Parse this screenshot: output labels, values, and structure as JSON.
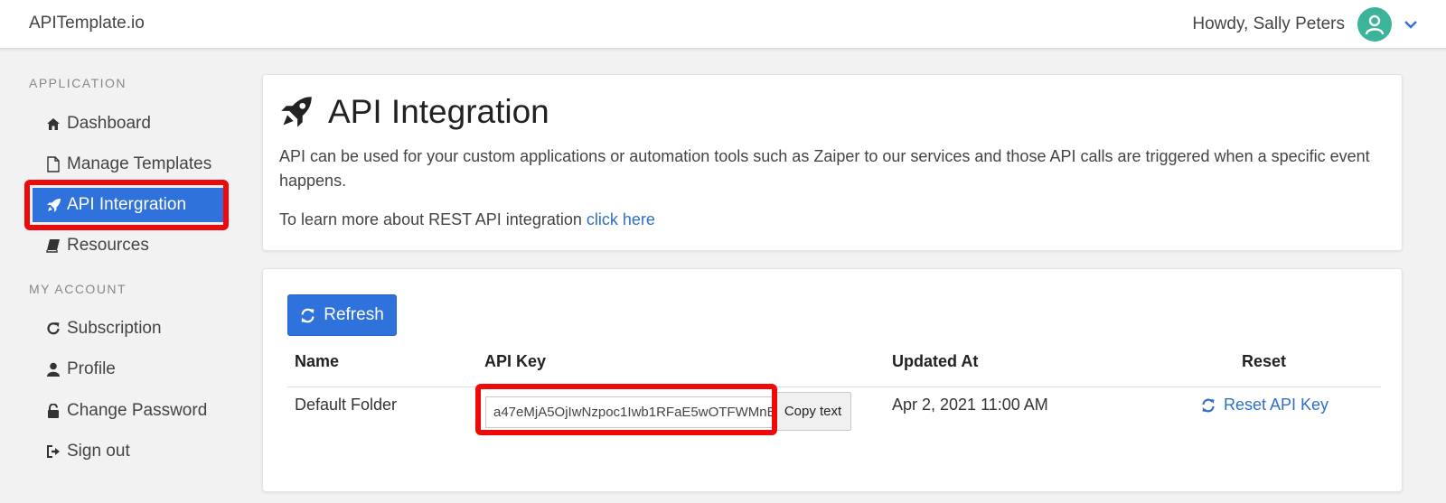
{
  "header": {
    "brand": "APITemplate.io",
    "greeting": "Howdy, Sally Peters",
    "avatar_color": "#3cb499"
  },
  "sidebar": {
    "sections": [
      {
        "title": "APPLICATION",
        "items": [
          {
            "label": "Dashboard",
            "icon": "home-icon"
          },
          {
            "label": "Manage Templates",
            "icon": "file-icon"
          },
          {
            "label": "API Intergration",
            "icon": "rocket-icon",
            "active": true
          },
          {
            "label": "Resources",
            "icon": "book-icon"
          }
        ]
      },
      {
        "title": "MY ACCOUNT",
        "items": [
          {
            "label": "Subscription",
            "icon": "refresh-icon"
          },
          {
            "label": "Profile",
            "icon": "user-icon"
          },
          {
            "label": "Change Password",
            "icon": "unlock-icon"
          },
          {
            "label": "Sign out",
            "icon": "sign-out-icon"
          }
        ]
      }
    ]
  },
  "main": {
    "title": "API Integration",
    "description": "API can be used for your custom applications or automation tools such as Zaiper to our services and those API calls are triggered when a specific event happens.",
    "learn_more_text": "To learn more about REST API integration",
    "learn_more_link": "click here",
    "refresh_label": "Refresh",
    "table": {
      "headers": [
        "Name",
        "API Key",
        "Updated At",
        "Reset"
      ],
      "rows": [
        {
          "name": "Default Folder",
          "api_key": "a47eMjA5OjIwNzpoc1Iwb1RFaE5wOTFWMnE",
          "copy_label": "Copy text",
          "updated_at": "Apr 2, 2021 11:00 AM",
          "reset_label": "Reset API Key"
        }
      ]
    }
  },
  "colors": {
    "primary": "#2f72db",
    "link": "#2f6fc7",
    "highlight": "#ee0a0a"
  }
}
